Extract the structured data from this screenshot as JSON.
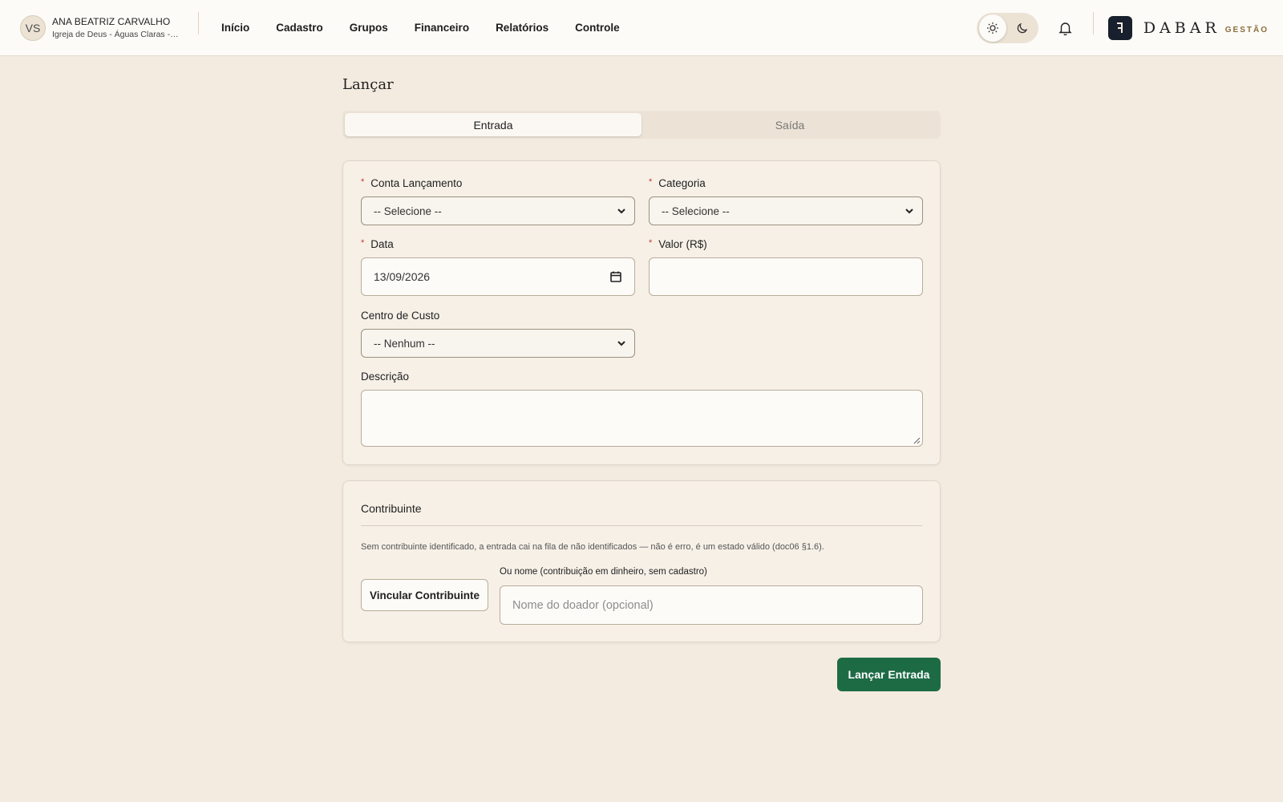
{
  "header": {
    "user_initials": "VS",
    "user_name": "ANA BEATRIZ CARVALHO",
    "user_org": "Igreja de Deus - Águas Claras - I...",
    "nav": [
      "Início",
      "Cadastro",
      "Grupos",
      "Financeiro",
      "Relatórios",
      "Controle"
    ],
    "theme": "light",
    "logo_word": "DABAR",
    "logo_sub": "GESTÃO",
    "logo_color": "#17202c"
  },
  "page": {
    "title": "Lançar",
    "tabs": [
      {
        "label": "Entrada",
        "active": true
      },
      {
        "label": "Saída",
        "active": false
      }
    ]
  },
  "form": {
    "required_mark": "*",
    "conta_label": "Conta Lançamento",
    "conta_value": "-- Selecione --",
    "categoria_label": "Categoria",
    "categoria_value": "-- Selecione --",
    "data_label": "Data",
    "data_value": "13/09/2026",
    "valor_label": "Valor (R$)",
    "valor_value": "",
    "centro_label": "Centro de Custo",
    "centro_value": "-- Nenhum --",
    "descricao_label": "Descrição",
    "descricao_value": ""
  },
  "contribuinte": {
    "title": "Contribuinte",
    "hint": "Sem contribuinte identificado, a entrada cai na fila de não identificados — não é erro, é um estado válido (doc06 §1.6).",
    "link_button": "Vincular Contribuinte",
    "name_label": "Ou nome (contribuição em dinheiro, sem cadastro)",
    "name_placeholder": "Nome do doador (opcional)"
  },
  "actions": {
    "submit": "Lançar Entrada",
    "submit_color": "#1d6b45"
  }
}
